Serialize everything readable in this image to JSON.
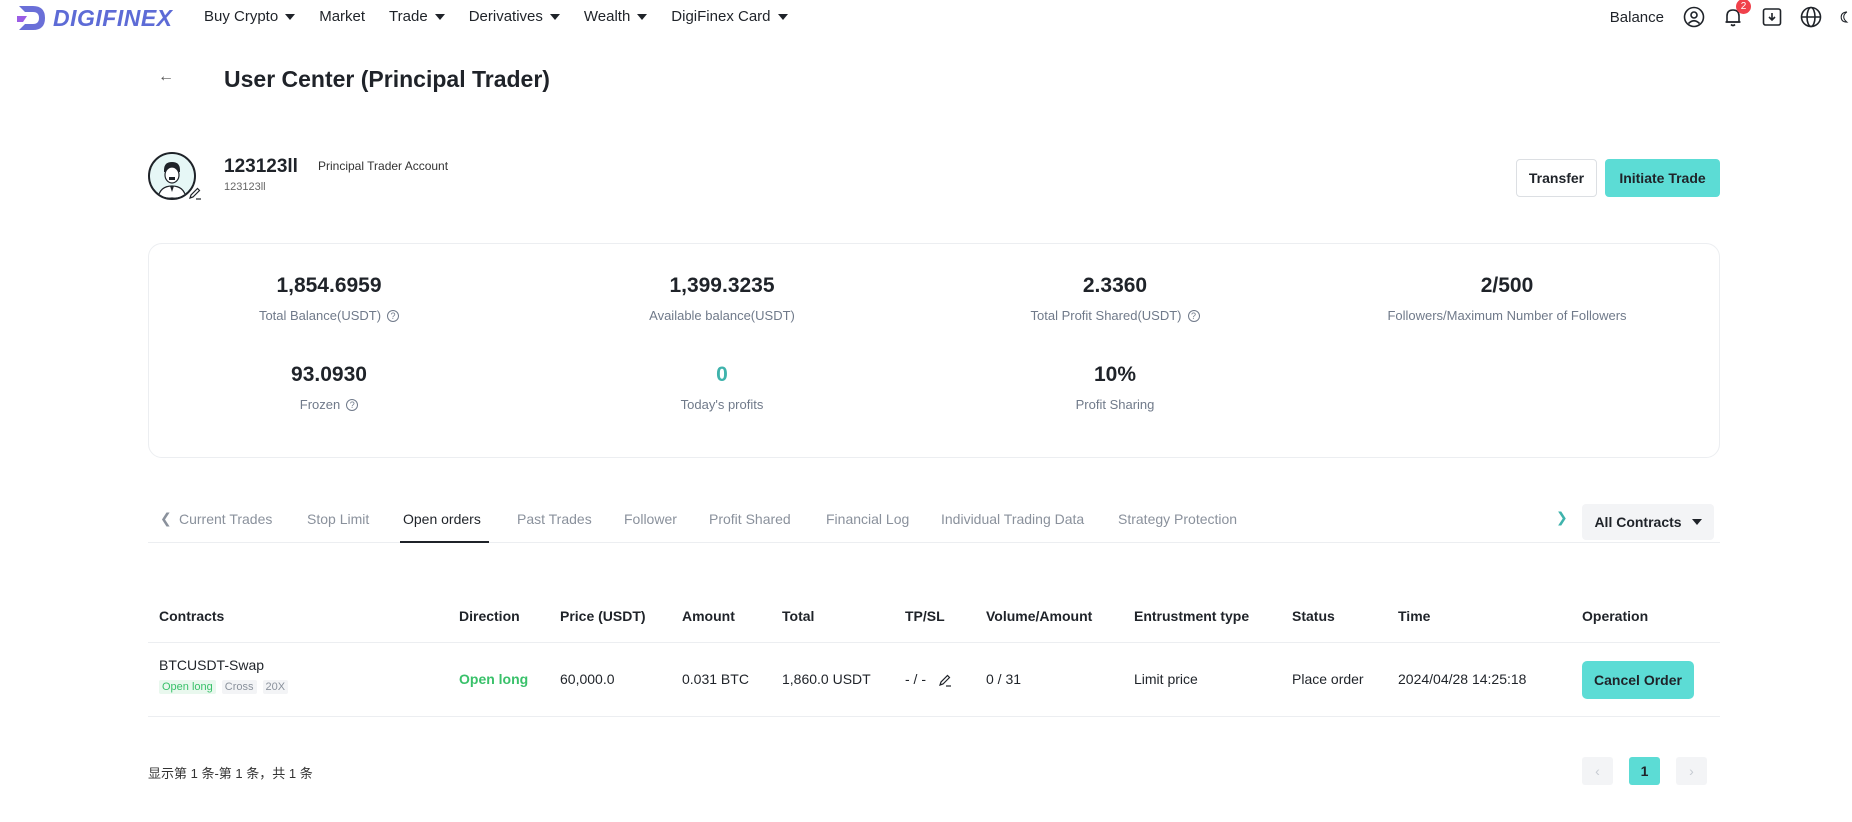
{
  "nav": {
    "logo_text": "DIGIFINEX",
    "items": [
      {
        "label": "Buy Crypto",
        "caret": true
      },
      {
        "label": "Market",
        "caret": false
      },
      {
        "label": "Trade",
        "caret": true
      },
      {
        "label": "Derivatives",
        "caret": true
      },
      {
        "label": "Wealth",
        "caret": true
      },
      {
        "label": "DigiFinex Card",
        "caret": true
      }
    ],
    "balance_label": "Balance",
    "notification_count": "2",
    "icons": [
      "user-icon",
      "bell-icon",
      "download-icon",
      "globe-icon",
      "moon-icon"
    ]
  },
  "header": {
    "back_label": "←",
    "title": "User Center (Principal Trader)"
  },
  "profile": {
    "username": "123123ll",
    "user_id": "123123ll",
    "account_type": "Principal Trader Account",
    "transfer_label": "Transfer",
    "initiate_label": "Initiate Trade"
  },
  "stats": {
    "total_balance": {
      "value": "1,854.6959",
      "label": "Total Balance(USDT)"
    },
    "available_balance": {
      "value": "1,399.3235",
      "label": "Available balance(USDT)"
    },
    "total_profit_shared": {
      "value": "2.3360",
      "label": "Total Profit Shared(USDT)"
    },
    "followers": {
      "value": "2/500",
      "label": "Followers/Maximum Number of Followers"
    },
    "frozen": {
      "value": "93.0930",
      "label": "Frozen"
    },
    "todays_profits": {
      "value": "0",
      "label": "Today's profits"
    },
    "profit_sharing": {
      "value": "10%",
      "label": "Profit Sharing"
    }
  },
  "tabs": {
    "items": [
      "Current Trades",
      "Stop Limit",
      "Open orders",
      "Past Trades",
      "Follower",
      "Profit Shared",
      "Financial Log",
      "Individual Trading Data",
      "Strategy Protection"
    ],
    "active": "Open orders",
    "filter_label": "All Contracts"
  },
  "table": {
    "headers": {
      "contracts": "Contracts",
      "direction": "Direction",
      "price": "Price (USDT)",
      "amount": "Amount",
      "total": "Total",
      "tpsl": "TP/SL",
      "volume": "Volume/Amount",
      "entrustment": "Entrustment type",
      "status": "Status",
      "time": "Time",
      "operation": "Operation"
    },
    "rows": [
      {
        "pair": "BTCUSDT-Swap",
        "tag_direction": "Open long",
        "tag_margin": "Cross",
        "tag_leverage": "20X",
        "direction": "Open long",
        "price": "60,000.0",
        "amount": "0.031 BTC",
        "total": "1,860.0 USDT",
        "tpsl": "- / -",
        "volume": "0 / 31",
        "entrustment": "Limit price",
        "status": "Place order",
        "time": "2024/04/28 14:25:18",
        "operation_label": "Cancel Order"
      }
    ]
  },
  "pagination": {
    "summary": "显示第 1 条-第 1 条，共 1 条",
    "current_page": "1",
    "prev_label": "‹",
    "next_label": "›"
  },
  "colors": {
    "brand": "#5d6bd6",
    "accent": "#5cdcd5",
    "positive": "#39c16a",
    "teal_text": "#3fb3ac"
  }
}
